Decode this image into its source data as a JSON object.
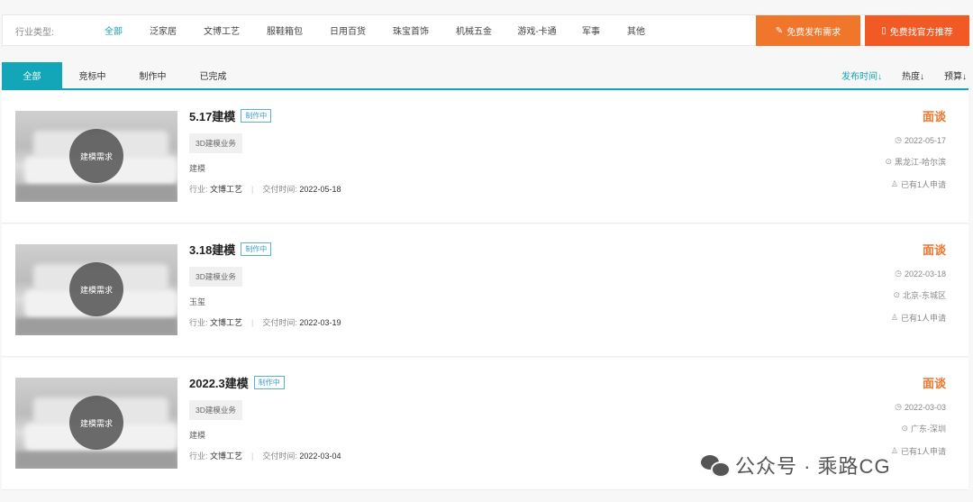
{
  "filter": {
    "label": "行业类型:",
    "categories": [
      "全部",
      "泛家居",
      "文博工艺",
      "服鞋箱包",
      "日用百货",
      "珠宝首饰",
      "机械五金",
      "游戏-卡通",
      "军事",
      "其他"
    ],
    "active_index": 0
  },
  "buttons": {
    "publish": "免费发布需求",
    "find": "免费找官方推荐"
  },
  "tabs": [
    "全部",
    "竞标中",
    "制作中",
    "已完成"
  ],
  "sorts": [
    "发布时间↓",
    "热度↓",
    "预算↓"
  ],
  "cards": [
    {
      "thumb_label": "建模需求",
      "title": "5.17建模",
      "status": "制作中",
      "tag": "3D建模业务",
      "desc": "建模",
      "industry_label": "行业:",
      "industry": "文博工艺",
      "delivery_label": "交付时间:",
      "delivery": "2022-05-18",
      "price": "面谈",
      "date": "2022-05-17",
      "location": "黑龙江-哈尔滨",
      "applicants": "已有1人申请"
    },
    {
      "thumb_label": "建模需求",
      "title": "3.18建模",
      "status": "制作中",
      "tag": "3D建模业务",
      "desc": "玉玺",
      "industry_label": "行业:",
      "industry": "文博工艺",
      "delivery_label": "交付时间:",
      "delivery": "2022-03-19",
      "price": "面谈",
      "date": "2022-03-18",
      "location": "北京-东城区",
      "applicants": "已有1人申请"
    },
    {
      "thumb_label": "建模需求",
      "title": "2022.3建模",
      "status": "制作中",
      "tag": "3D建模业务",
      "desc": "建模",
      "industry_label": "行业:",
      "industry": "文博工艺",
      "delivery_label": "交付时间:",
      "delivery": "2022-03-04",
      "price": "面谈",
      "date": "2022-03-03",
      "location": "广东-深圳",
      "applicants": "已有1人申请"
    }
  ],
  "watermark": "公众号 · 乘路CG"
}
